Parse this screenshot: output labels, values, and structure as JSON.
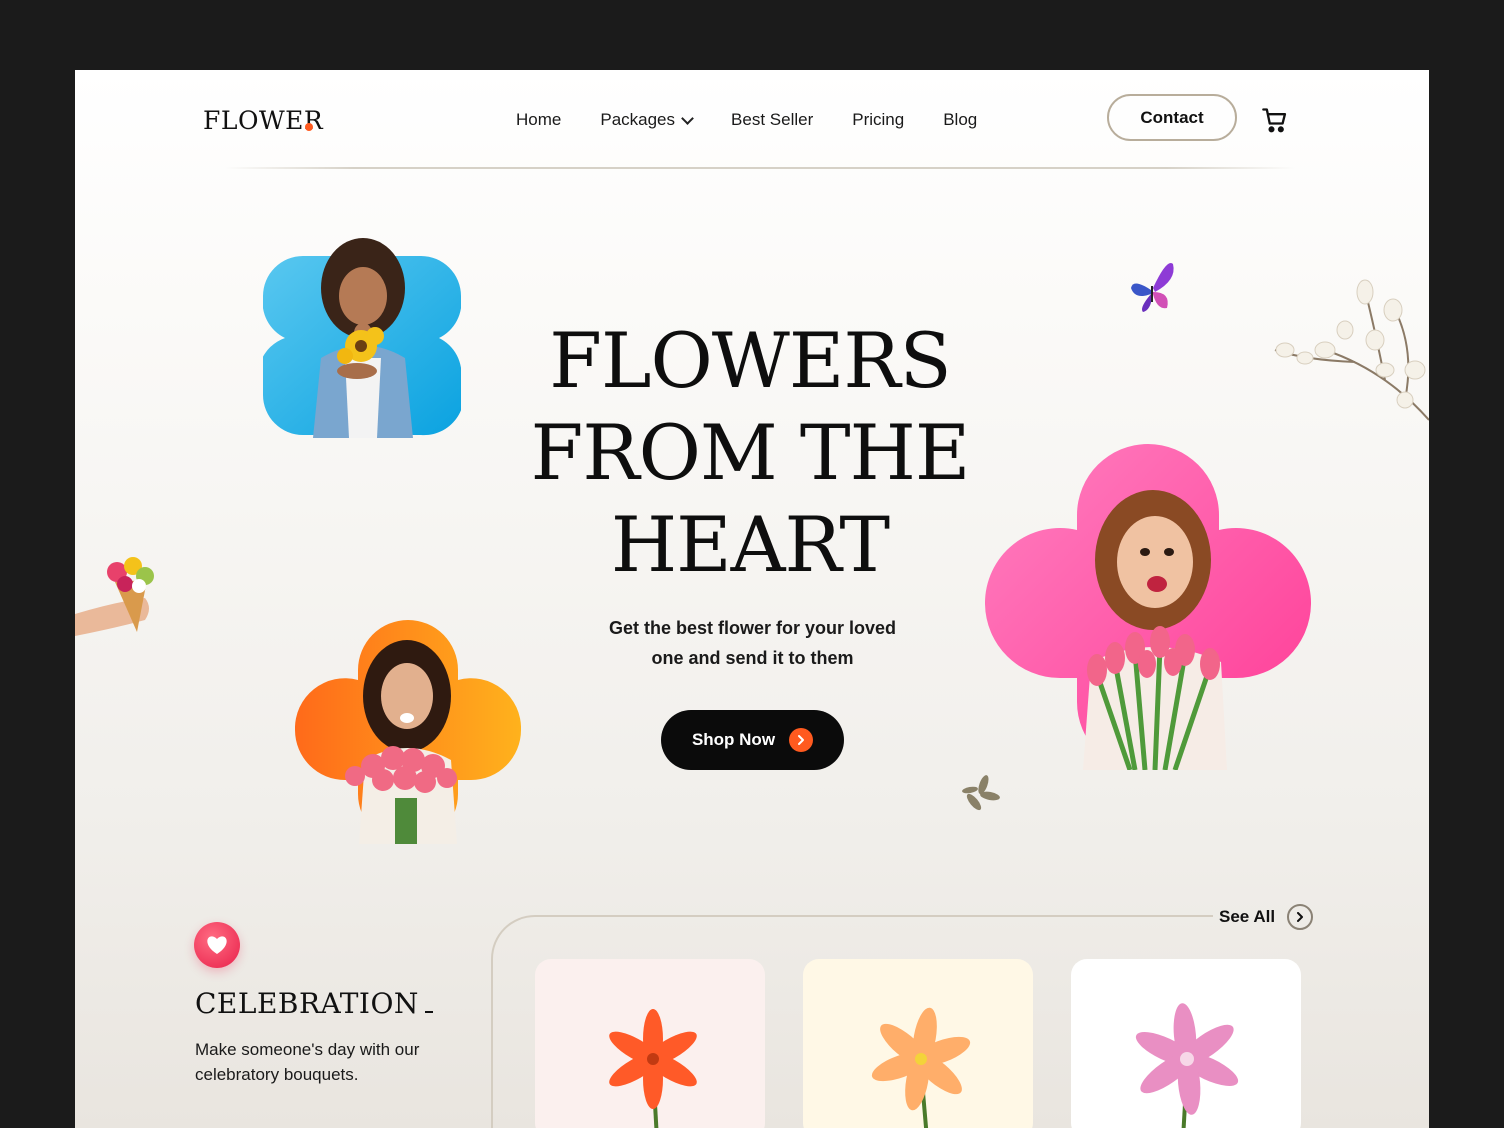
{
  "brand": {
    "name": "FLOWER",
    "accent": "#ff5a1f"
  },
  "nav": {
    "items": [
      {
        "label": "Home"
      },
      {
        "label": "Packages"
      },
      {
        "label": "Best Seller"
      },
      {
        "label": "Pricing"
      },
      {
        "label": "Blog"
      }
    ],
    "contact_label": "Contact",
    "cart_icon": "cart-icon"
  },
  "hero": {
    "title_lines": [
      "FLOWERS",
      "FROM THE",
      "HEART"
    ],
    "subtitle_line1": "Get the best flower for your loved",
    "subtitle_line2": "one and send it to them",
    "cta_label": "Shop Now"
  },
  "photos": {
    "girl_blue": {
      "color": "#29b3ea"
    },
    "woman_orange": {
      "color": "#ff8a00"
    },
    "woman_pink": {
      "color": "#ff4fa3"
    }
  },
  "celebration": {
    "title": "CELEBRATION",
    "description": "Make someone's day with our celebratory bouquets.",
    "badge_icon": "heart-icon"
  },
  "products": {
    "see_all_label": "See All",
    "cards": [
      {
        "bg": "#fbf0ee",
        "flower_color": "#ff5a28"
      },
      {
        "bg": "#fff8e6",
        "flower_color": "#ffae6a"
      },
      {
        "bg": "#ffffff",
        "flower_color": "#e98fc3"
      }
    ]
  }
}
